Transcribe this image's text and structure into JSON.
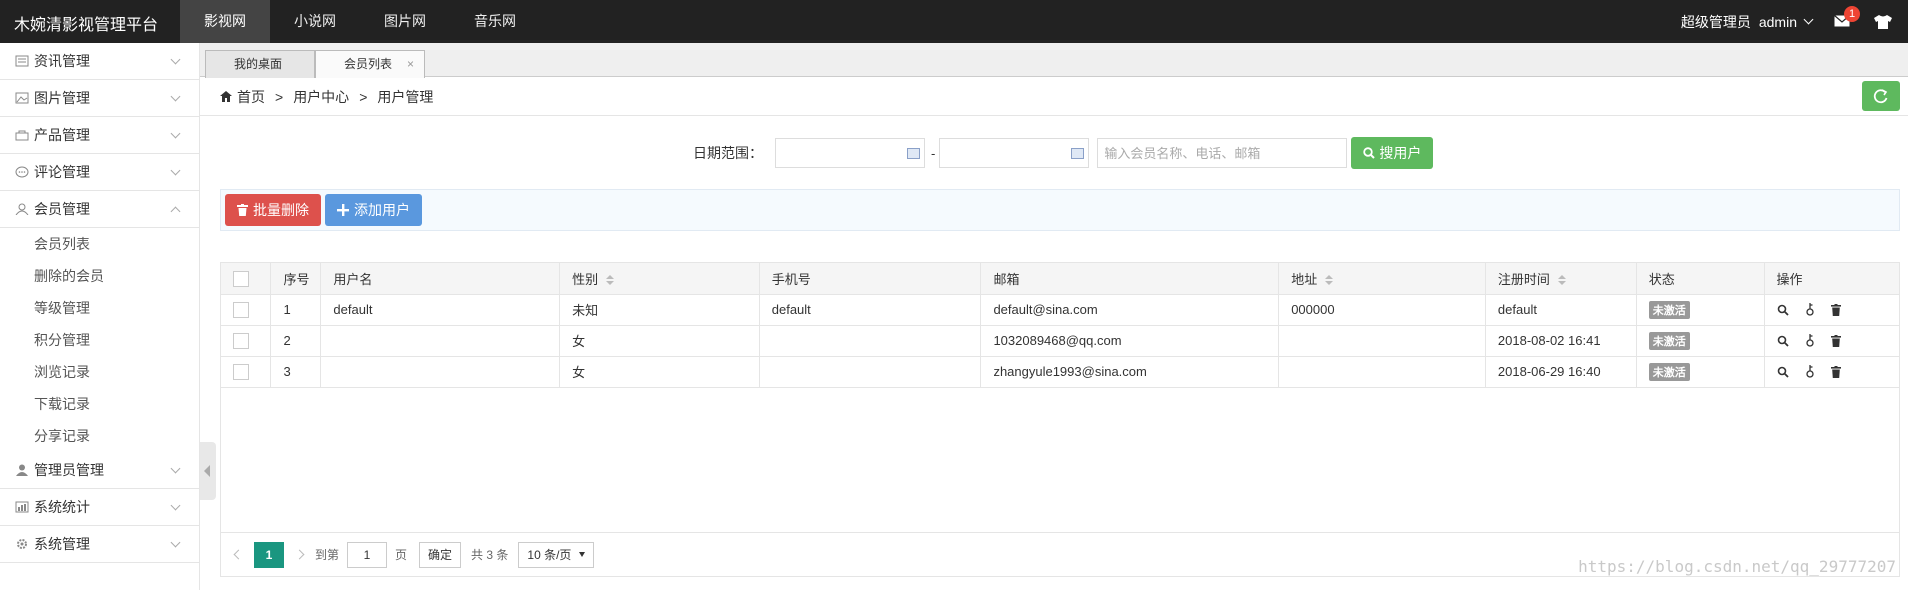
{
  "topbar": {
    "logo": "木婉清影视管理平台",
    "nav": [
      "影视网",
      "小说网",
      "图片网",
      "音乐网"
    ],
    "role": "超级管理员",
    "user": "admin",
    "message_count": "1"
  },
  "sidebar": {
    "menus": [
      {
        "label": "资讯管理",
        "icon": "news-icon"
      },
      {
        "label": "图片管理",
        "icon": "picture-icon"
      },
      {
        "label": "产品管理",
        "icon": "bag-icon"
      },
      {
        "label": "评论管理",
        "icon": "comment-icon"
      },
      {
        "label": "会员管理",
        "icon": "user-icon"
      },
      {
        "label": "管理员管理",
        "icon": "admin-icon"
      },
      {
        "label": "系统统计",
        "icon": "stats-icon"
      },
      {
        "label": "系统管理",
        "icon": "gear-icon"
      }
    ],
    "member_sub": [
      "会员列表",
      "删除的会员",
      "等级管理",
      "积分管理",
      "浏览记录",
      "下载记录",
      "分享记录"
    ]
  },
  "tabs": [
    {
      "label": "我的桌面"
    },
    {
      "label": "会员列表",
      "close": "×"
    }
  ],
  "breadcrumb": {
    "home": "首页",
    "sep": ">",
    "level1": "用户中心",
    "level2": "用户管理"
  },
  "search": {
    "label": "日期范围：",
    "dash": "-",
    "placeholder": "输入会员名称、电话、邮箱",
    "button": "搜用户"
  },
  "toolbar": {
    "batch_delete": "批量删除",
    "add_user": "添加用户"
  },
  "table": {
    "headers": [
      "序号",
      "用户名",
      "性别",
      "手机号",
      "邮箱",
      "地址",
      "注册时间",
      "状态",
      "操作"
    ],
    "rows": [
      {
        "id": "1",
        "username": "default",
        "gender": "未知",
        "phone": "default",
        "email": "default@sina.com",
        "address": "000000",
        "reg_time": "default",
        "status": "未激活"
      },
      {
        "id": "2",
        "username": "",
        "gender": "女",
        "phone": "",
        "email": "1032089468@qq.com",
        "address": "",
        "reg_time": "2018-08-02 16:41",
        "status": "未激活"
      },
      {
        "id": "3",
        "username": "",
        "gender": "女",
        "phone": "",
        "email": "zhangyule1993@sina.com",
        "address": "",
        "reg_time": "2018-06-29 16:40",
        "status": "未激活"
      }
    ]
  },
  "pager": {
    "current": "1",
    "goto": "到第",
    "goto_value": "1",
    "page": "页",
    "confirm": "确定",
    "total": "共 3 条",
    "size": "10 条/页"
  },
  "watermark": "https://blog.csdn.net/qq_29777207",
  "colors": {
    "green": "#5eb95e",
    "red": "#dd514c",
    "blue": "#5a98de",
    "pager_active": "#1a9680"
  }
}
